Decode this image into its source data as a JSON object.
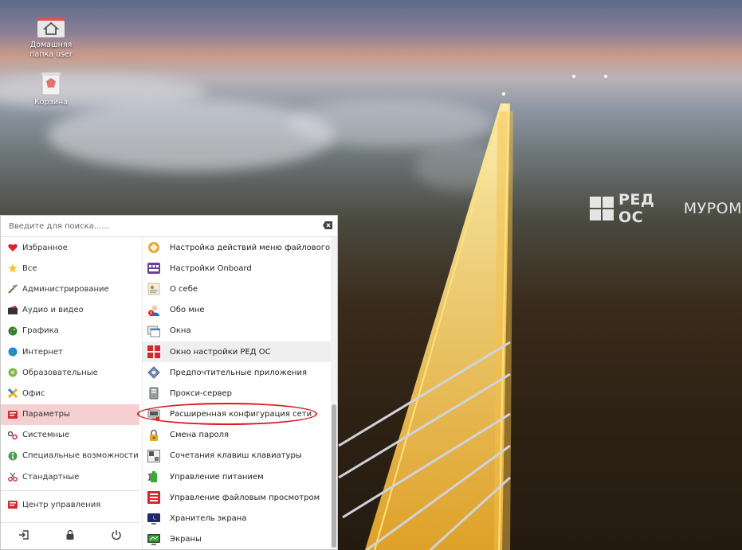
{
  "desktop": {
    "icons": [
      {
        "label": "Домашняя папка user"
      },
      {
        "label": "Корзина"
      }
    ],
    "watermark": {
      "brand": "РЕД ОС",
      "sub": "МУРОМ"
    }
  },
  "search": {
    "placeholder": "Введите для поиска......"
  },
  "categories": [
    {
      "label": "Избранное",
      "icon": "heart-icon",
      "selected": false
    },
    {
      "label": "Все",
      "icon": "star-icon",
      "selected": false
    },
    {
      "label": "Администрирование",
      "icon": "tools-icon",
      "selected": false
    },
    {
      "label": "Аудио и видео",
      "icon": "film-icon",
      "selected": false
    },
    {
      "label": "Графика",
      "icon": "palette-icon",
      "selected": false
    },
    {
      "label": "Интернет",
      "icon": "globe-icon",
      "selected": false
    },
    {
      "label": "Образовательные",
      "icon": "education-icon",
      "selected": false
    },
    {
      "label": "Офис",
      "icon": "office-icon",
      "selected": false
    },
    {
      "label": "Параметры",
      "icon": "settings-icon",
      "selected": true
    },
    {
      "label": "Системные",
      "icon": "system-icon",
      "selected": false
    },
    {
      "label": "Специальные возможности",
      "icon": "accessibility-icon",
      "selected": false
    },
    {
      "label": "Стандартные",
      "icon": "accessories-icon",
      "selected": false
    }
  ],
  "control_center": {
    "label": "Центр управления"
  },
  "apps": [
    {
      "label": "Настройка действий меню файлового менеджера",
      "icon": "file-manager-actions-icon"
    },
    {
      "label": "Настройки Onboard",
      "icon": "keyboard-icon"
    },
    {
      "label": "О себе",
      "icon": "about-me-icon"
    },
    {
      "label": "Обо мне",
      "icon": "user-info-icon"
    },
    {
      "label": "Окна",
      "icon": "windows-icon"
    },
    {
      "label": "Окно настройки РЕД ОС",
      "icon": "red-os-settings-icon"
    },
    {
      "label": "Предпочтительные приложения",
      "icon": "preferred-apps-icon"
    },
    {
      "label": "Прокси-сервер",
      "icon": "proxy-icon"
    },
    {
      "label": "Расширенная конфигурация сети",
      "icon": "network-config-icon"
    },
    {
      "label": "Смена пароля",
      "icon": "password-icon"
    },
    {
      "label": "Сочетания клавиш клавиатуры",
      "icon": "keyboard-shortcuts-icon"
    },
    {
      "label": "Управление питанием",
      "icon": "power-management-icon"
    },
    {
      "label": "Управление файловым просмотром",
      "icon": "file-view-icon"
    },
    {
      "label": "Хранитель экрана",
      "icon": "screensaver-icon"
    },
    {
      "label": "Экраны",
      "icon": "displays-icon"
    }
  ],
  "colors": {
    "selected_bg": "#f6cfd0",
    "circle": "#d9181f"
  }
}
